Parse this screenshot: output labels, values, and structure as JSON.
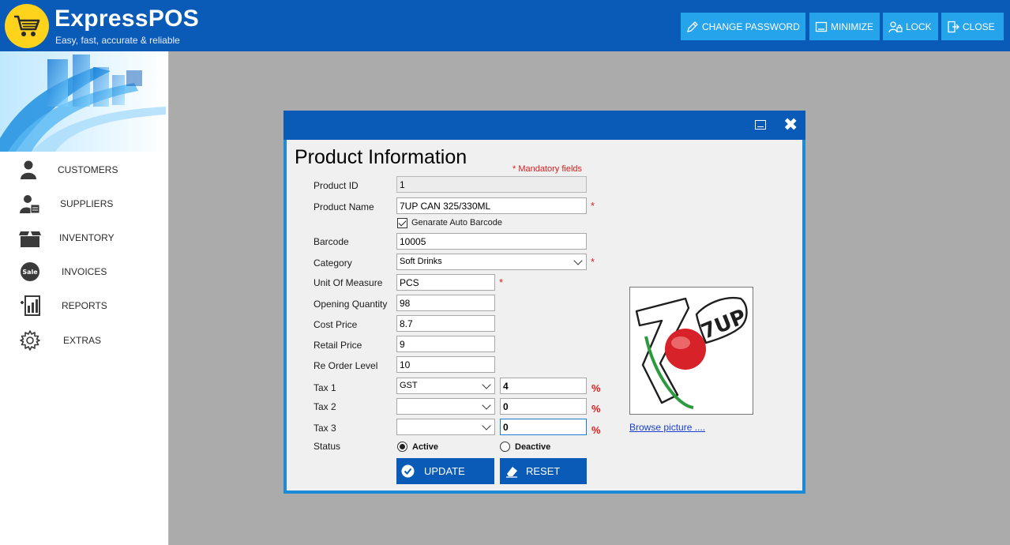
{
  "app": {
    "title": "ExpressPOS",
    "subtitle": "Easy, fast, accurate & reliable"
  },
  "toolbar": {
    "change_password": "CHANGE PASSWORD",
    "minimize": "MINIMIZE",
    "lock": "LOCK",
    "close": "CLOSE"
  },
  "sidebar": {
    "items": [
      {
        "label": "CUSTOMERS",
        "icon": "user-icon"
      },
      {
        "label": "SUPPLIERS",
        "icon": "supplier-icon"
      },
      {
        "label": "INVENTORY",
        "icon": "box-icon"
      },
      {
        "label": "INVOICES",
        "icon": "sale-badge-icon"
      },
      {
        "label": "REPORTS",
        "icon": "report-chart-icon"
      },
      {
        "label": "EXTRAS",
        "icon": "gear-icon"
      }
    ]
  },
  "form": {
    "title": "Product Information",
    "mandatory_note": "* Mandatory fields",
    "fields": {
      "product_id": {
        "label": "Product ID",
        "value": "1"
      },
      "product_name": {
        "label": "Product Name",
        "value": "7UP CAN 325/330ML"
      },
      "auto_barcode": {
        "label": "Genarate Auto Barcode",
        "checked": true
      },
      "barcode": {
        "label": "Barcode",
        "value": "10005"
      },
      "category": {
        "label": "Category",
        "value": "Soft Drinks"
      },
      "unit": {
        "label": "Unit Of Measure",
        "value": "PCS"
      },
      "opening_qty": {
        "label": "Opening Quantity",
        "value": "98"
      },
      "cost_price": {
        "label": "Cost Price",
        "value": "8.7"
      },
      "retail_price": {
        "label": "Retail Price",
        "value": "9"
      },
      "reorder_level": {
        "label": "Re Order Level",
        "value": "10"
      },
      "tax1": {
        "label": "Tax 1",
        "type": "GST",
        "value": "4"
      },
      "tax2": {
        "label": "Tax 2",
        "type": "",
        "value": "0"
      },
      "tax3": {
        "label": "Tax 3",
        "type": "",
        "value": "0"
      },
      "status": {
        "label": "Status",
        "active": "Active",
        "deactive": "Deactive",
        "selected": "Active"
      }
    },
    "star": "*",
    "percent": "%",
    "update_label": "UPDATE",
    "reset_label": "RESET",
    "browse_label": "Browse picture ....",
    "product_image_text": "7UP"
  },
  "colors": {
    "header": "#0a5bb8",
    "button": "#25a4ec",
    "mandatory": "#d81e1e"
  }
}
